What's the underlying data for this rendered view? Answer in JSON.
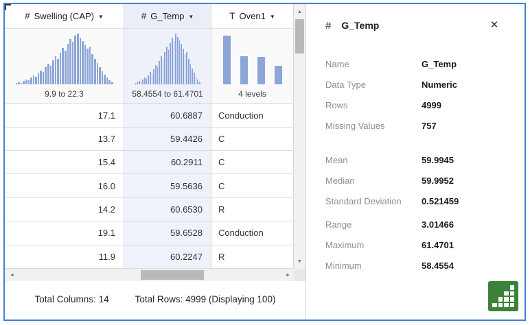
{
  "colors": {
    "window_border": "#3f80d6",
    "histogram_fill": "#8da6d8",
    "selected_column_tint": "#eff2fb",
    "chart_button_green": "#3b8339",
    "panel_label_gray": "#8e8e8e"
  },
  "table": {
    "caret_icon": "▼",
    "columns": [
      {
        "icon": "#",
        "label": "Swelling (CAP)",
        "range": "9.9 to 22.3",
        "selected": false,
        "chart": {
          "type": "histogram",
          "bins": [
            2,
            4,
            3,
            7,
            9,
            8,
            13,
            17,
            15,
            22,
            27,
            24,
            33,
            40,
            36,
            47,
            55,
            50,
            62,
            72,
            66,
            80,
            90,
            84,
            96,
            100,
            92,
            86,
            78,
            70,
            74,
            60,
            50,
            42,
            34,
            26,
            19,
            13,
            8,
            4
          ]
        }
      },
      {
        "icon": "#",
        "label": "G_Temp",
        "range": "58.4554 to 61.4701",
        "selected": true,
        "chart": {
          "type": "histogram",
          "bins": [
            2,
            4,
            6,
            5,
            9,
            13,
            11,
            18,
            24,
            21,
            30,
            38,
            34,
            46,
            55,
            50,
            63,
            74,
            68,
            82,
            92,
            86,
            100,
            94,
            87,
            80,
            70,
            60,
            64,
            50,
            40,
            31,
            23,
            15,
            9,
            4
          ]
        }
      },
      {
        "icon": "T",
        "label": "Oven1",
        "range": "4 levels",
        "selected": false,
        "chart": {
          "type": "bar",
          "values": [
            96,
            56,
            54,
            36
          ]
        }
      }
    ],
    "rows": [
      [
        "17.1",
        "60.6887",
        "Conduction"
      ],
      [
        "13.7",
        "59.4426",
        "C"
      ],
      [
        "15.4",
        "60.2911",
        "C"
      ],
      [
        "16.0",
        "59.5636",
        "C"
      ],
      [
        "14.2",
        "60.6530",
        "R"
      ],
      [
        "19.1",
        "59.6528",
        "Conduction"
      ],
      [
        "11.9",
        "60.2247",
        "R"
      ]
    ],
    "footer": {
      "total_columns": "Total Columns: 14",
      "total_rows": "Total Rows: 4999 (Displaying 100)"
    }
  },
  "panel": {
    "icon": "#",
    "title": "G_Temp",
    "close_icon": "✕",
    "groups": [
      {
        "fields": [
          {
            "label": "Name",
            "value": "G_Temp"
          },
          {
            "label": "Data Type",
            "value": "Numeric"
          },
          {
            "label": "Rows",
            "value": "4999"
          },
          {
            "label": "Missing Values",
            "value": "757"
          }
        ]
      },
      {
        "fields": [
          {
            "label": "Mean",
            "value": "59.9945"
          },
          {
            "label": "Median",
            "value": "59.9952"
          },
          {
            "label": "Standard Deviation",
            "value": "0.521459"
          }
        ]
      },
      {
        "fields": [
          {
            "label": "Range",
            "value": "3.01466"
          },
          {
            "label": "Maximum",
            "value": "61.4701"
          },
          {
            "label": "Minimum",
            "value": "58.4554"
          }
        ]
      }
    ]
  }
}
